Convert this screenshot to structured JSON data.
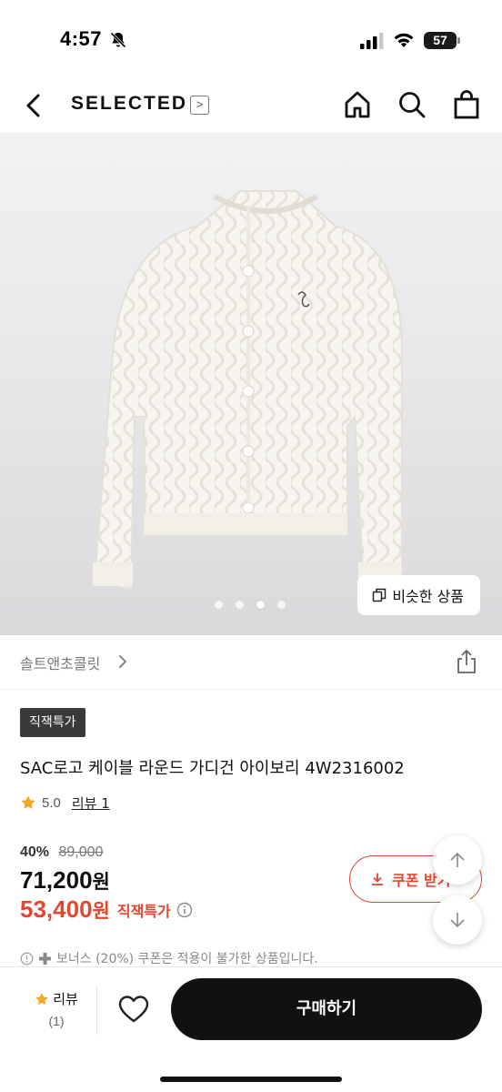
{
  "status_bar": {
    "time": "4:57",
    "battery": "57"
  },
  "nav": {
    "brand": "SELECTED",
    "brand_arrow": ">"
  },
  "gallery": {
    "page_count": 4,
    "active_index": 2,
    "similar_label": "비슷한 상품"
  },
  "store": {
    "name": "솔트앤초콜릿"
  },
  "product": {
    "badge": "직잭특가",
    "title": "SAC로고 케이블 라운드 가디건 아이보리 4W2316002",
    "rating": "5.0",
    "review_label": "리뷰 1",
    "discount_rate": "40%",
    "original_price": "89,000",
    "sale_price": "71,200",
    "won": "원",
    "special_price": "53,400",
    "special_label": "직잭특가",
    "coupon_label": "쿠폰 받기",
    "bonus_note": "보너스 (20%) 쿠폰은 적용이 불가한 상품입니다."
  },
  "bottom_bar": {
    "review_label": "리뷰",
    "review_count": "(1)",
    "buy_label": "구매하기"
  },
  "colors": {
    "accent": "#e2472f",
    "star": "#f5a623",
    "dark": "#111111"
  }
}
